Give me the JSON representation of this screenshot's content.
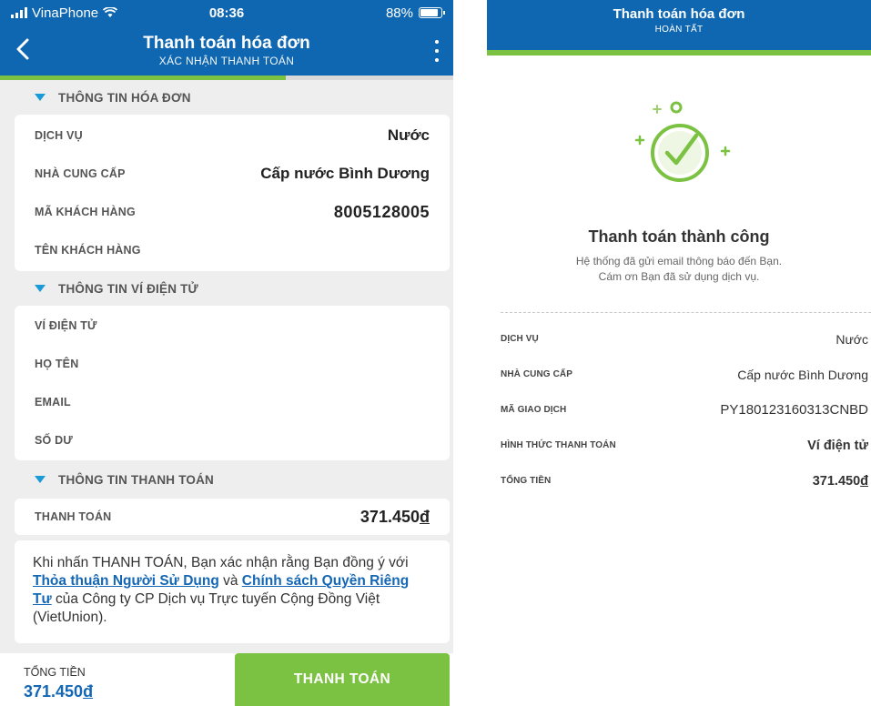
{
  "left": {
    "status": {
      "carrier": "VinaPhone",
      "time": "08:36",
      "battery": "88%"
    },
    "nav": {
      "title": "Thanh toán hóa đơn",
      "subtitle": "XÁC NHẬN THANH TOÁN",
      "progress": 0.63
    },
    "invoice": {
      "heading": "THÔNG TIN HÓA ĐƠN",
      "rows": [
        {
          "label": "DỊCH VỤ",
          "value": "Nước"
        },
        {
          "label": "NHÀ CUNG CẤP",
          "value": "Cấp nước Bình Dương"
        },
        {
          "label": "MÃ KHÁCH HÀNG",
          "value": "8005128005"
        },
        {
          "label": "TÊN KHÁCH HÀNG",
          "value": ""
        }
      ]
    },
    "wallet": {
      "heading": "THÔNG TIN VÍ ĐIỆN TỬ",
      "rows": [
        {
          "label": "VÍ ĐIỆN TỬ",
          "value": ""
        },
        {
          "label": "HỌ TÊN",
          "value": ""
        },
        {
          "label": "EMAIL",
          "value": ""
        },
        {
          "label": "SỐ DƯ",
          "value": ""
        }
      ]
    },
    "payment": {
      "heading": "THÔNG TIN THANH TOÁN",
      "label": "THANH TOÁN",
      "amount": "371.450",
      "currency": "đ"
    },
    "notice": {
      "t1": "Khi nhấn THANH TOÁN, Bạn xác nhận rằng Bạn đồng ý với ",
      "link1": "Thỏa thuận Người Sử Dụng",
      "t2": " và ",
      "link2": "Chính sách Quyền Riêng Tư",
      "t3": " của Công ty CP Dịch vụ Trực tuyến Cộng Đồng Việt (VietUnion)."
    },
    "footer": {
      "total_label": "TỔNG TIỀN",
      "total_amount": "371.450",
      "currency": "đ",
      "pay_button": "THANH TOÁN"
    }
  },
  "right": {
    "header": {
      "title": "Thanh toán hóa đơn",
      "subtitle": "HOÀN TẤT"
    },
    "heading": "Thanh toán thành công",
    "message_line1": "Hệ thống đã gửi email thông báo đến Bạn.",
    "message_line2": "Cám ơn Bạn đã sử dụng dịch vụ.",
    "rows": [
      {
        "label": "DỊCH VỤ",
        "value": "Nước"
      },
      {
        "label": "NHÀ CUNG CẤP",
        "value": "Cấp nước Bình Dương"
      },
      {
        "label": "MÃ GIAO DỊCH",
        "value": "PY180123160313CNBD"
      },
      {
        "label": "HÌNH THỨC THANH TOÁN",
        "value": "Ví điện tử"
      },
      {
        "label": "TỔNG TIỀN",
        "value": "371.450",
        "currency": "đ"
      }
    ]
  },
  "colors": {
    "brand_blue": "#0f67b1",
    "accent_green": "#7cc242",
    "link_blue": "#1467b5",
    "triangle_blue": "#1a9ad6"
  },
  "icons": [
    "back-icon",
    "more-vertical-icon",
    "signal-icon",
    "wifi-icon",
    "battery-icon",
    "success-check-icon"
  ]
}
